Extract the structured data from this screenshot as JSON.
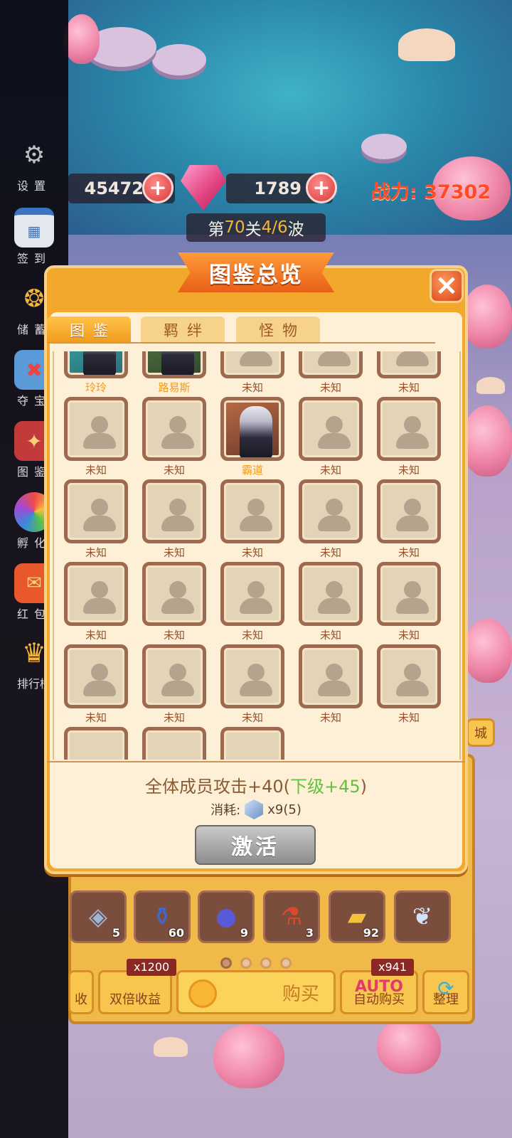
{
  "hud": {
    "coins": "45472",
    "gems": "1789",
    "power": "战力: 37302",
    "wave": {
      "prefix": "第",
      "level": "70",
      "mid": "关",
      "wave": "4/6",
      "suffix": "波"
    }
  },
  "sidebar": [
    {
      "label": "设置",
      "icon": "gear-icon"
    },
    {
      "label": "签到",
      "icon": "calendar-icon"
    },
    {
      "label": "储蓄",
      "icon": "coin-bag-icon"
    },
    {
      "label": "夺宝",
      "icon": "treasure-map-icon"
    },
    {
      "label": "图鉴",
      "icon": "book-icon"
    },
    {
      "label": "孵化",
      "icon": "egg-icon"
    },
    {
      "label": "红包",
      "icon": "red-envelope-icon"
    },
    {
      "label": "排行榜",
      "icon": "trophy-icon"
    }
  ],
  "modal": {
    "title": "图鉴总览",
    "tabs": [
      "图鉴",
      "羁绊",
      "怪物"
    ],
    "active_tab": "图鉴",
    "rows": [
      [
        "玲玲",
        "路易斯",
        "未知",
        "未知",
        "未知"
      ],
      [
        "未知",
        "未知",
        "霸道",
        "未知",
        "未知"
      ],
      [
        "未知",
        "未知",
        "未知",
        "未知",
        "未知"
      ],
      [
        "未知",
        "未知",
        "未知",
        "未知",
        "未知"
      ],
      [
        "未知",
        "未知",
        "未知",
        "未知",
        "未知"
      ]
    ],
    "bonus": {
      "main": "全体成员攻击+40(",
      "next": "下级+45",
      "close": ")"
    },
    "cost": {
      "label": "消耗:",
      "value": "x9(5)"
    },
    "activate_label": "激活"
  },
  "inventory": [
    {
      "icon": "rune-stone-icon",
      "count": "5"
    },
    {
      "icon": "blue-potion-icon",
      "count": "60"
    },
    {
      "icon": "plum-fruit-icon",
      "count": "9"
    },
    {
      "icon": "red-potion-icon",
      "count": "3"
    },
    {
      "icon": "gold-ticket-icon",
      "count": "92"
    },
    {
      "icon": "feather-icon",
      "count": ""
    }
  ],
  "bottom_bar": {
    "collect_label": "收",
    "double_label": "双倍收益",
    "double_tag": "x1200",
    "buy_label": "购买",
    "auto_label": "自动购买",
    "auto_tag": "x941",
    "auto_badge": "AUTO",
    "sort_label": "整理",
    "shop_label": "城"
  },
  "colors": {
    "modal_bg": "#f2a82a",
    "unknown_label": "#9a4f2a",
    "known_label": "#f29a1e",
    "power": "#ff4a2a",
    "bonus_next": "#62c23e"
  }
}
